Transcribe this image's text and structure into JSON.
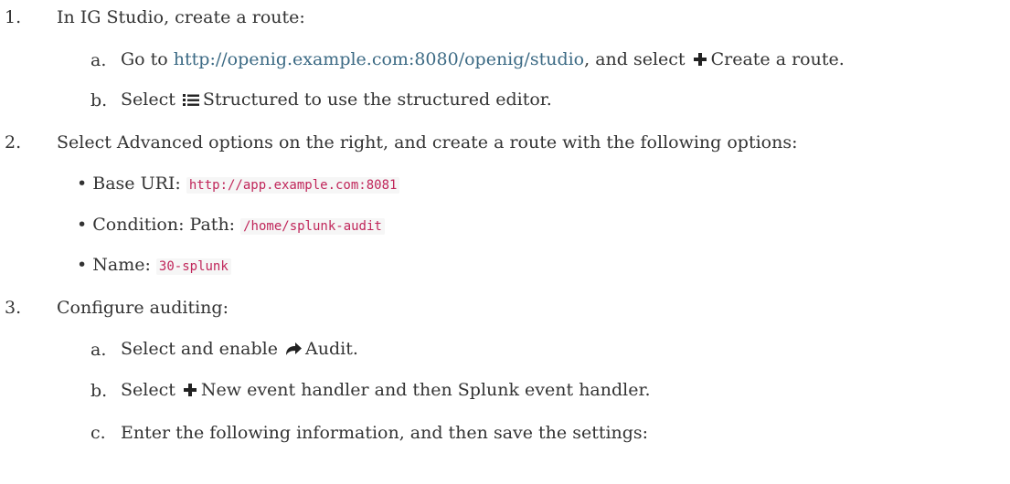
{
  "steps": [
    {
      "number": "1.",
      "text": "In IG Studio, create a route:",
      "substeps": [
        {
          "letter": "a.",
          "pre": "Go to ",
          "link": "http://openig.example.com:8080/openig/studio",
          "mid": ", and select ",
          "icon": "plus-icon",
          "post": "Create a route."
        },
        {
          "letter": "b.",
          "pre": "Select ",
          "icon": "list-icon",
          "post": "Structured to use the structured editor."
        }
      ]
    },
    {
      "number": "2.",
      "text": "Select Advanced options on the right, and create a route with the following options:",
      "bullets": [
        {
          "label": "Base URI: ",
          "code": "http://app.example.com:8081"
        },
        {
          "label": "Condition: Path: ",
          "code": "/home/splunk-audit"
        },
        {
          "label": "Name: ",
          "code": "30-splunk"
        }
      ]
    },
    {
      "number": "3.",
      "text": "Configure auditing:",
      "substeps": [
        {
          "letter": "a.",
          "pre": "Select and enable ",
          "icon": "share-arrow-icon",
          "post": "Audit."
        },
        {
          "letter": "b.",
          "pre": "Select ",
          "icon": "plus-icon",
          "post": "New event handler and then Splunk event handler."
        },
        {
          "letter": "c.",
          "text": "Enter the following information, and then save the settings:"
        }
      ]
    }
  ],
  "bullet_char": "•"
}
